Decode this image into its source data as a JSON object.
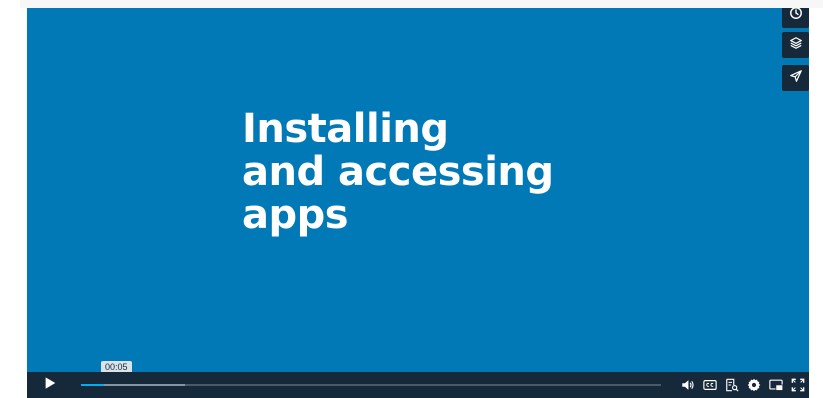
{
  "video": {
    "title_lines": [
      "Installing",
      "and accessing",
      "apps"
    ],
    "current_time": "00:05",
    "played_fraction": 0.04,
    "buffered_fraction": 0.18
  },
  "side_controls": [
    "clock-icon",
    "layers-icon",
    "send-icon"
  ],
  "controls": {
    "play_icon": "play-icon",
    "right_icons": [
      "volume-icon",
      "closed-captions-icon",
      "transcript-icon",
      "settings-icon",
      "picture-in-picture-icon",
      "fullscreen-icon"
    ]
  },
  "colors": {
    "background": "#0179b6",
    "control_bar": "#15293b",
    "progress": "#00adef",
    "text": "#ffffff"
  }
}
